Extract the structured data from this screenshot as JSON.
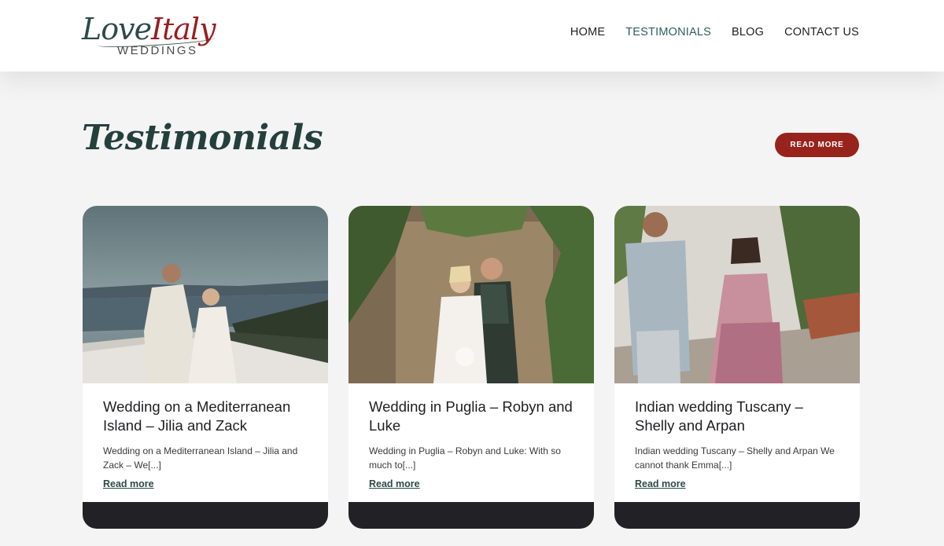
{
  "logo": {
    "line1_a": "Love",
    "line1_b": "Italy",
    "line2": "WEDDINGS"
  },
  "nav": {
    "items": [
      {
        "label": "HOME"
      },
      {
        "label": "TESTIMONIALS"
      },
      {
        "label": "BLOG"
      },
      {
        "label": "CONTACT US"
      }
    ],
    "active": "TESTIMONIALS"
  },
  "section": {
    "title": "Testimonials",
    "button_label": "READ MORE"
  },
  "cards": [
    {
      "title": "Wedding on a Mediterranean Island – Jilia and Zack",
      "excerpt": "Wedding on a Mediterranean Island – Jilia and Zack – We[...]",
      "link": "Read more"
    },
    {
      "title": "Wedding in Puglia – Robyn and Luke",
      "excerpt": "Wedding in Puglia – Robyn and Luke: With so much to[...]",
      "link": "Read more"
    },
    {
      "title": "Indian wedding Tuscany – Shelly and Arpan",
      "excerpt": "Indian wedding Tuscany – Shelly and Arpan We cannot thank Emma[...]",
      "link": "Read more"
    }
  ],
  "colors": {
    "brand_green": "#2e4a46",
    "brand_red": "#98231d",
    "active_nav": "#2e5f5c",
    "card_footer": "#222226"
  }
}
